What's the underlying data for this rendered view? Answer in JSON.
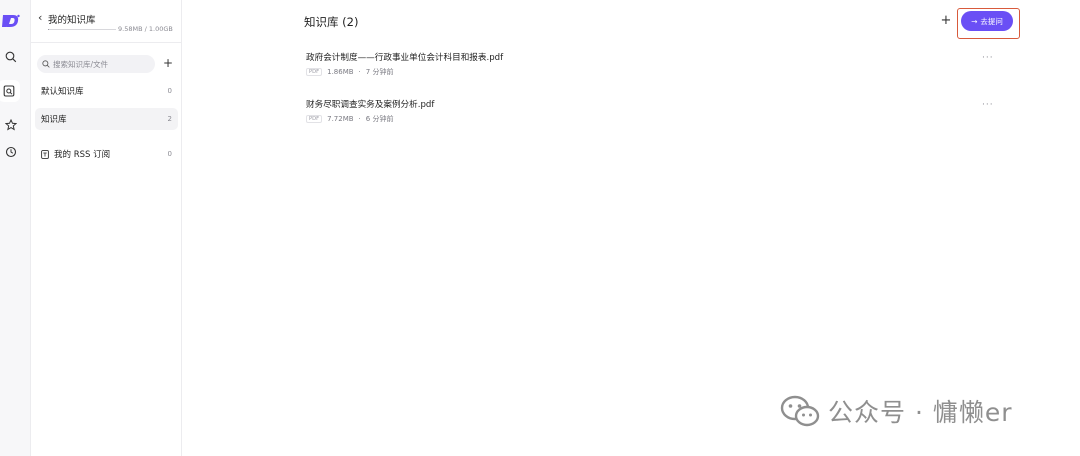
{
  "rail": {
    "icons": [
      "app-logo",
      "search-icon",
      "knowledge-base-icon",
      "star-icon",
      "history-icon"
    ]
  },
  "panel": {
    "back_glyph": "‹",
    "title": "我的知识库",
    "usage_text": "9.58MB / 1.00GB",
    "usage_fraction": 0.0094,
    "search_placeholder": "搜索知识库/文件",
    "add_glyph": "+",
    "items": [
      {
        "label": "默认知识库",
        "count": "0"
      },
      {
        "label": "知识库",
        "count": "2"
      }
    ],
    "rss": {
      "label": "我的 RSS 订阅",
      "count": "0"
    }
  },
  "main": {
    "title": "知识库 (2)",
    "add_glyph": "+",
    "ask_button": {
      "arrow": "→",
      "label": "去提问"
    },
    "files": [
      {
        "name": "政府会计制度——行政事业单位会计科目和报表.pdf",
        "type": "PDF",
        "size": "1.86MB",
        "time": "7 分钟前",
        "more": "···"
      },
      {
        "name": "财务尽职调查实务及案例分析.pdf",
        "type": "PDF",
        "size": "7.72MB",
        "time": "6 分钟前",
        "more": "···"
      }
    ]
  },
  "watermark": {
    "text": "公众号 · 慵懒er"
  },
  "colors": {
    "accent": "#6a4ff5",
    "highlight_border": "#d85a3b",
    "logo": "#6a4ff5"
  }
}
